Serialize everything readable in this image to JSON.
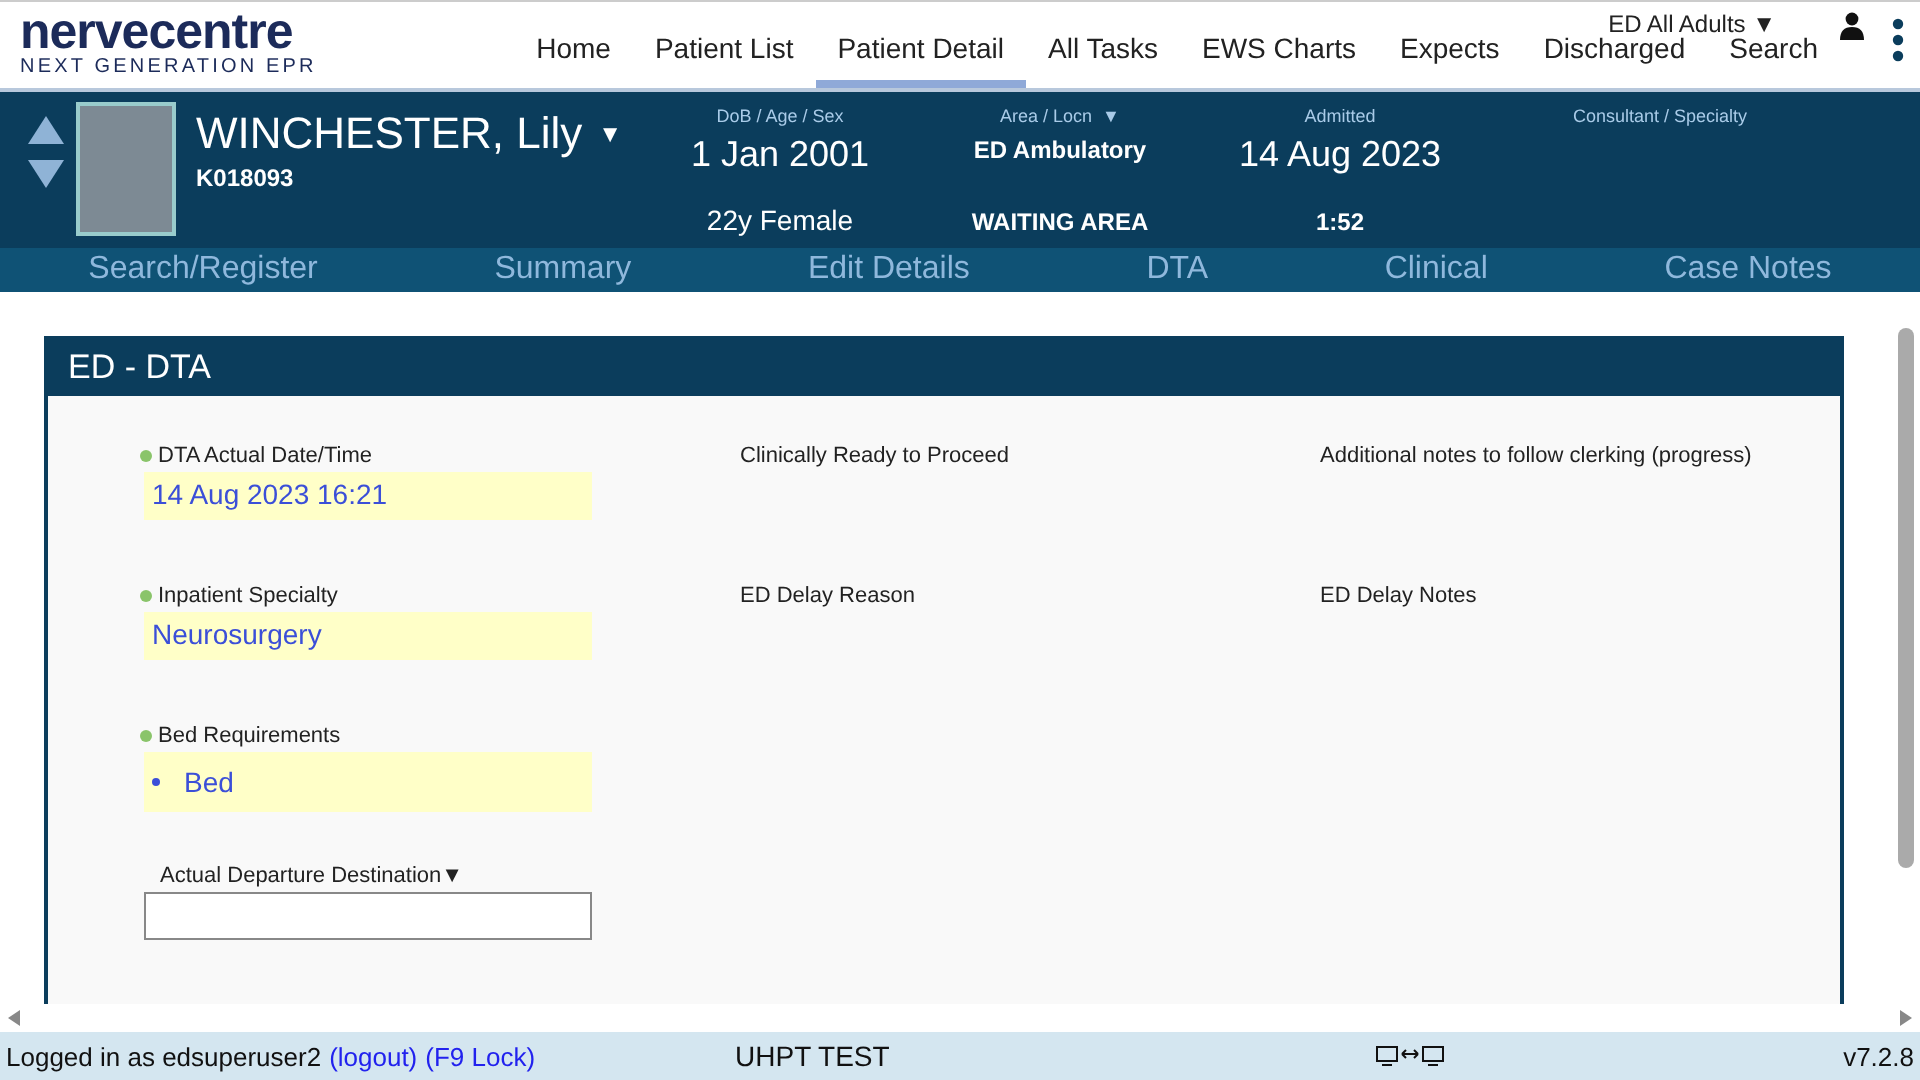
{
  "header": {
    "logo": "nervecentre",
    "tagline": "NEXT GENERATION EPR",
    "nav": [
      {
        "label": "Home",
        "selected": false
      },
      {
        "label": "Patient List",
        "selected": false
      },
      {
        "label": "Patient Detail",
        "selected": true
      },
      {
        "label": "All Tasks",
        "selected": false
      },
      {
        "label": "EWS Charts",
        "selected": false
      },
      {
        "label": "Expects",
        "selected": false
      },
      {
        "label": "Discharged",
        "selected": false
      },
      {
        "label": "Search",
        "selected": false
      }
    ],
    "ward_selector": "ED All Adults ▼"
  },
  "patient": {
    "name": "WINCHESTER, Lily",
    "name_caret": "▼",
    "number": "K018093",
    "fields": [
      {
        "label": "DoB / Age / Sex",
        "value": "1 Jan 2001",
        "value_2": "22y Female"
      },
      {
        "label": "Area / Locn  ▼",
        "value": "ED Ambulatory",
        "value_2": "WAITING AREA"
      },
      {
        "label": "Admitted",
        "value": "14 Aug 2023",
        "value_2": "1:52"
      },
      {
        "label": "Consultant / Specialty"
      }
    ]
  },
  "tabs": [
    {
      "label": "Search/Register",
      "selected": false
    },
    {
      "label": "Summary",
      "selected": false
    },
    {
      "label": "Edit Details",
      "selected": false
    },
    {
      "label": "DTA",
      "selected": false
    },
    {
      "label": "Clinical",
      "selected": false
    },
    {
      "label": "Case Notes",
      "selected": false
    }
  ],
  "form": {
    "title": "ED - DTA",
    "columns": [
      [
        {
          "kind": "value",
          "label": "DTA Actual Date/Time",
          "required": true,
          "value": "14 Aug 2023 16:21"
        },
        {
          "kind": "value",
          "label": "Inpatient Specialty",
          "required": true,
          "value": "Neurosurgery"
        },
        {
          "kind": "list",
          "label": "Bed Requirements",
          "required": true,
          "items": [
            "Bed"
          ]
        },
        {
          "kind": "input",
          "label": "Actual Departure Destination▼",
          "required": false
        }
      ],
      [
        {
          "kind": "label",
          "label": "Clinically Ready to Proceed",
          "required": false
        },
        {
          "kind": "label",
          "label": "ED Delay Reason",
          "required": false
        }
      ],
      [
        {
          "kind": "label",
          "label": "Additional notes to follow clerking (progress)",
          "required": false
        },
        {
          "kind": "label",
          "label": "ED Delay Notes",
          "required": false
        }
      ]
    ]
  },
  "status_bar": {
    "login": "Logged in as edsuperuser2",
    "logout": "(logout)",
    "lock": "(F9 Lock)",
    "environment": "UHPT TEST",
    "version": "v7.2.8"
  }
}
